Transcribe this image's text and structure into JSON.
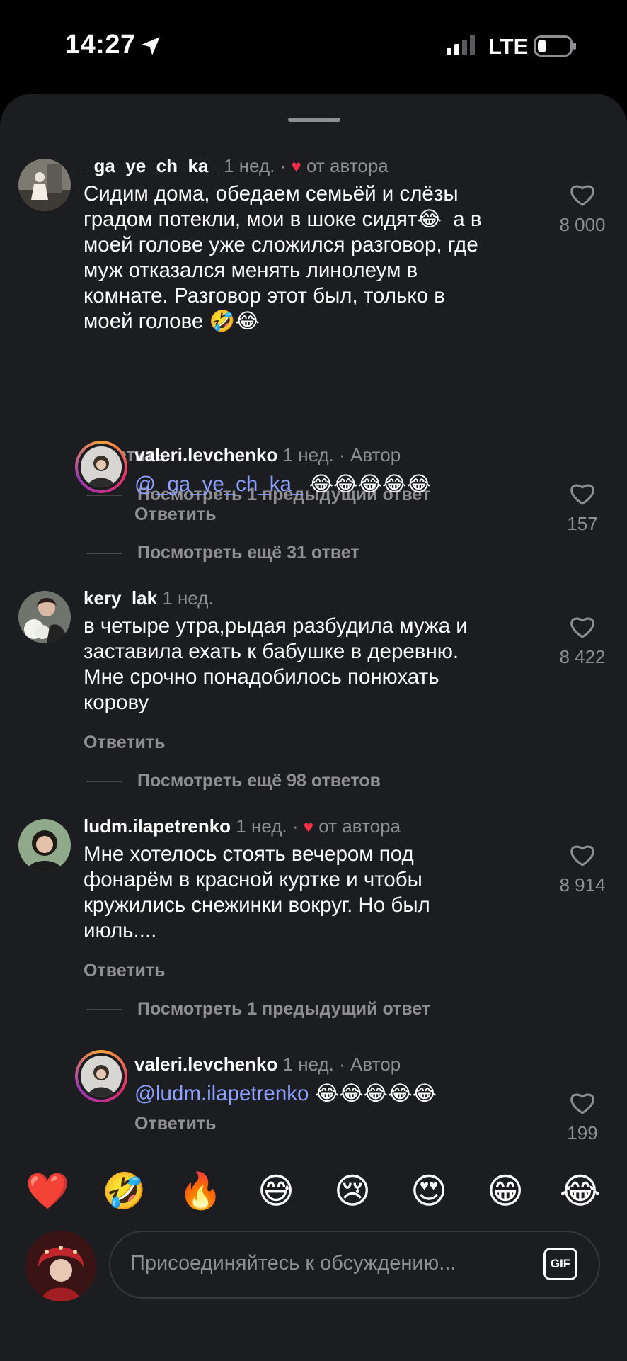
{
  "status_bar": {
    "time": "14:27",
    "network": "LTE"
  },
  "comments": [
    {
      "username": "_ga_ye_ch_ka_",
      "time": "1 нед.",
      "author_like": "от автора",
      "text": "Сидим дома, обедаем семьёй и слёзы\nградом потекли, мои в шоке сидят😂  а в\nмоей голове уже сложился разговор, где\nмуж отказался менять линолеум в\nкомнате. Разговор этот был, только в\nмоей голове 🤣😂",
      "reply_label": "Ответить",
      "likes": "8 000",
      "more_label": "Посмотреть 1 предыдущий ответ"
    },
    {
      "username": "valeri.levchenko",
      "time": "1 нед.",
      "badge": "Автор",
      "mention": "@_ga_ye_ch_ka_",
      "text": " 😂😂😂😂😂",
      "reply_label": "Ответить",
      "likes": "157",
      "more_label": "Посмотреть ещё 31 ответ"
    },
    {
      "username": "kery_lak",
      "time": "1 нед.",
      "text": "в четыре утра,рыдая разбудила мужа и\nзаставила ехать к бабушке в деревню.\nМне срочно понадобилось понюхать\nкорову",
      "reply_label": "Ответить",
      "likes": "8 422",
      "more_label": "Посмотреть ещё 98 ответов"
    },
    {
      "username": "ludm.ilapetrenko",
      "time": "1 нед.",
      "author_like": "от автора",
      "text": "Мне хотелось стоять вечером под\nфонарём в красной куртке и чтобы\nкружились снежинки вокруг. Но был\nиюль....",
      "reply_label": "Ответить",
      "likes": "8 914",
      "more_label": "Посмотреть 1 предыдущий ответ"
    },
    {
      "username": "valeri.levchenko",
      "time": "1 нед.",
      "badge": "Автор",
      "mention": "@ludm.ilapetrenko",
      "text": " 😂😂😂😂😂",
      "reply_label": "Ответить",
      "likes": "199"
    }
  ],
  "reactions": [
    "❤️",
    "🤣",
    "🔥",
    "😅",
    "😢",
    "😍",
    "😁",
    "😂"
  ],
  "composer": {
    "placeholder": "Присоединяйтесь к обсуждению...",
    "gif_label": "GIF"
  },
  "icons": [
    "location-arrow-icon",
    "signal-icon",
    "battery-icon",
    "heart-outline-icon",
    "heart-filled-icon",
    "gif-icon"
  ],
  "colors": {
    "background": "#1c1d20",
    "mention": "#8ea0ff",
    "secondary_text": "#8e8e93",
    "heart_red": "#ff2d46"
  }
}
